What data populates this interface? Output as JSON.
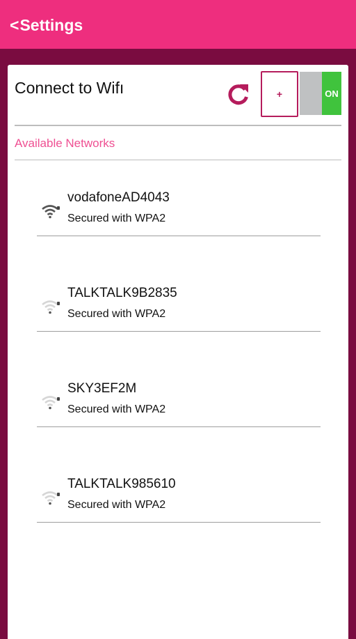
{
  "header": {
    "back_label": "Settings",
    "back_chevron": "<",
    "color": "#ee2e7e"
  },
  "panel": {
    "title": "Connect to Wifı",
    "add_label": "+",
    "toggle_label": "ON",
    "toggle_on": true,
    "section_label": "Available Networks",
    "accent_color": "#b51c5c",
    "toggle_color": "#40c33d"
  },
  "networks": [
    {
      "name": "vodafoneAD4043",
      "security": "Secured with WPA2",
      "signal_icon": "wifi-lock-icon",
      "signal": "strong"
    },
    {
      "name": "TALKTALK9B2835",
      "security": "Secured with WPA2",
      "signal_icon": "wifi-lock-icon",
      "signal": "weak"
    },
    {
      "name": "SKY3EF2M",
      "security": "Secured with WPA2",
      "signal_icon": "wifi-lock-icon",
      "signal": "weak"
    },
    {
      "name": "TALKTALK985610",
      "security": "Secured with WPA2",
      "signal_icon": "wifi-lock-icon",
      "signal": "weak"
    }
  ]
}
